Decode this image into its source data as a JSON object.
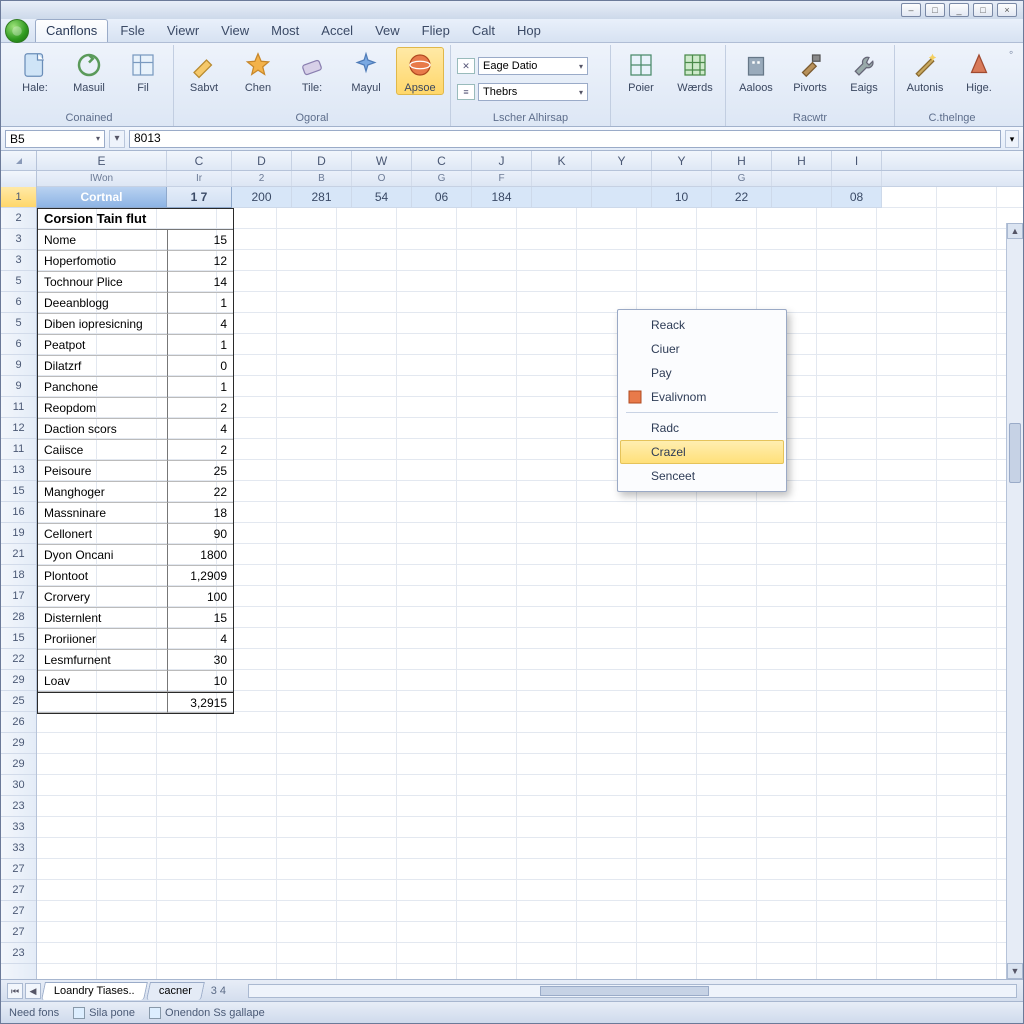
{
  "window_controls": {
    "min": "_",
    "max": "□",
    "close": "×",
    "h1": "–",
    "h2": "□"
  },
  "menubar": {
    "tabs": [
      "Canflons",
      "Fsle",
      "Viewr",
      "View",
      "Most",
      "Accel",
      "Vew",
      "Fliep",
      "Calt",
      "Hop"
    ],
    "active_index": 0
  },
  "ribbon": {
    "groups": [
      {
        "label": "Conained",
        "buttons": [
          "Hale:",
          "Masuil",
          "Fil"
        ]
      },
      {
        "label": "Ogoral",
        "buttons": [
          "Sabvt",
          "Chen",
          "Tile:",
          "Mayul",
          "Apsoe"
        ],
        "selected": 4
      },
      {
        "label": "Lscher Alhirsap",
        "combo1": "Eage Datio",
        "combo2": "Thebrs",
        "ico1": "✕",
        "ico2": "≡"
      },
      {
        "label": "",
        "buttons": [
          "Poier",
          "Wærds"
        ]
      },
      {
        "label": "Racwtr",
        "buttons": [
          "Aaloos",
          "Pivorts",
          "Eaigs"
        ]
      },
      {
        "label": "C.thelnge",
        "buttons": [
          "Autonis",
          "Hige."
        ]
      }
    ],
    "help_icon": "?"
  },
  "formula_bar": {
    "name_box": "B5",
    "formula": "8013",
    "sep": "▾"
  },
  "columns": {
    "main": [
      "▲",
      "E",
      "C",
      "D",
      "D",
      "W",
      "C",
      "J",
      "K",
      "Y",
      "Y",
      "H",
      "H",
      "I"
    ],
    "sub": [
      "",
      "IWon",
      "Ir",
      "2",
      "B",
      "O",
      "G",
      "F",
      "",
      "",
      "",
      "G",
      "",
      "",
      ""
    ]
  },
  "row1_values": {
    "E": "Cortnal",
    "C": "1 7",
    "D1": "200",
    "D2": "281",
    "W": "54",
    "C2": "06",
    "J": "184",
    "Y2": "10",
    "H1": "22",
    "I": "08"
  },
  "table": {
    "title": "Corsion Tain flut",
    "rows": [
      {
        "r": "3",
        "name": "Nome",
        "val": "15"
      },
      {
        "r": "3",
        "name": "Hoperfomotio",
        "val": "12"
      },
      {
        "r": "5",
        "name": "Tochnour Plice",
        "val": "14"
      },
      {
        "r": "6",
        "name": "Deeanblogg",
        "val": "1"
      },
      {
        "r": "5",
        "name": "Diben iopresicning",
        "val": "4"
      },
      {
        "r": "6",
        "name": "Peatpot",
        "val": "1"
      },
      {
        "r": "9",
        "name": "Dilatzrf",
        "val": "0"
      },
      {
        "r": "9",
        "name": "Panchone",
        "val": "1"
      },
      {
        "r": "11",
        "name": "Reopdom",
        "val": "2"
      },
      {
        "r": "12",
        "name": "Daction scors",
        "val": "4"
      },
      {
        "r": "11",
        "name": "Caiisce",
        "val": "2"
      },
      {
        "r": "13",
        "name": "Peisoure",
        "val": "25"
      },
      {
        "r": "15",
        "name": "Manghoger",
        "val": "22"
      },
      {
        "r": "16",
        "name": "Massninare",
        "val": "18"
      },
      {
        "r": "19",
        "name": "Cellonert",
        "val": "90"
      },
      {
        "r": "21",
        "name": "Dyon Oncani",
        "val": "1800"
      },
      {
        "r": "18",
        "name": "Plontoot",
        "val": "1,2909"
      },
      {
        "r": "17",
        "name": "Crorvery",
        "val": "100"
      },
      {
        "r": "28",
        "name": "Disternlent",
        "val": "15"
      },
      {
        "r": "15",
        "name": "Proriioner",
        "val": "4"
      },
      {
        "r": "22",
        "name": "Lesmfurnent",
        "val": "30"
      },
      {
        "r": "29",
        "name": "Loav",
        "val": "10"
      }
    ],
    "total_row": "25",
    "total_val": "3,2915"
  },
  "context_menu": {
    "items": [
      {
        "label": "Reack"
      },
      {
        "label": "Ciuer"
      },
      {
        "label": "Pay"
      },
      {
        "label": "Evalivnom",
        "icon": true
      },
      {
        "sep": true
      },
      {
        "label": "Radc"
      },
      {
        "label": "Crazel",
        "hover": true
      },
      {
        "label": "Senceet"
      }
    ]
  },
  "sheet_tabs": {
    "tabs": [
      "Loandry Tiases..",
      "cacner"
    ],
    "extra": "3 4"
  },
  "status_bar": {
    "items": [
      "Need fons",
      "Sila pone",
      "Onendon Ss gallape"
    ]
  },
  "empty_rows": [
    "26",
    "29",
    "29",
    "30",
    "23",
    "33",
    "33",
    "27",
    "27",
    "27",
    "27",
    "23"
  ]
}
